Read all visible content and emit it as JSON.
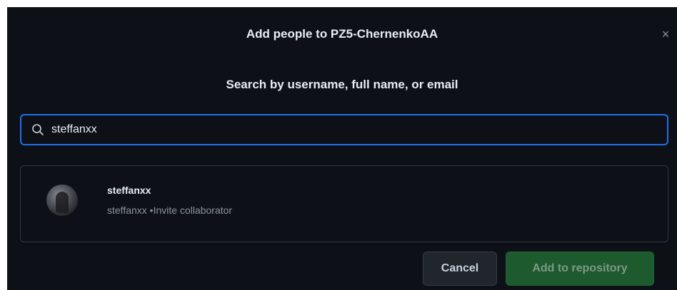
{
  "dialog": {
    "title": "Add people to PZ5-ChernenkoAA",
    "close_symbol": "×",
    "search_hint": "Search by username, full name, or email"
  },
  "search": {
    "value": "steffanxx",
    "icon": "search-icon"
  },
  "results": [
    {
      "name": "steffanxx",
      "subtitle": "steffanxx •Invite collaborator",
      "avatar": "avatar"
    }
  ],
  "buttons": {
    "cancel_label": "Cancel",
    "add_label": "Add to repository"
  },
  "colors": {
    "background": "#0d1117",
    "focus_border": "#1f6feb",
    "primary_disabled": "#1d5a2d",
    "secondary": "#21262d"
  }
}
